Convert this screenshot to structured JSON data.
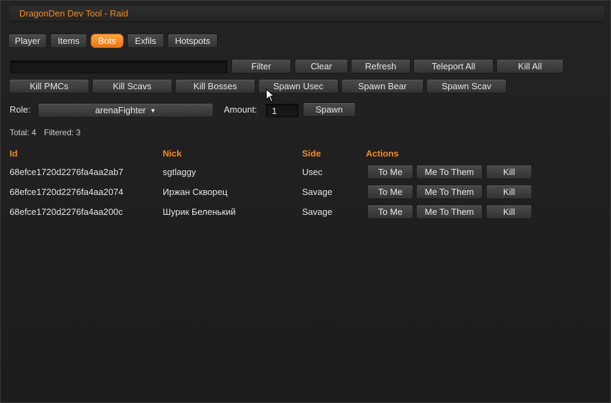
{
  "window": {
    "title": "DragonDen Dev Tool - Raid"
  },
  "tabs": [
    {
      "label": "Player",
      "active": false
    },
    {
      "label": "Items",
      "active": false
    },
    {
      "label": "Bots",
      "active": true
    },
    {
      "label": "Exfils",
      "active": false
    },
    {
      "label": "Hotspots",
      "active": false
    }
  ],
  "toolbar": {
    "search_value": "",
    "filter_label": "Filter",
    "clear_label": "Clear",
    "refresh_label": "Refresh",
    "teleport_all_label": "Teleport All",
    "kill_all_label": "Kill All",
    "kill_pmcs_label": "Kill PMCs",
    "kill_scavs_label": "Kill Scavs",
    "kill_bosses_label": "Kill Bosses",
    "spawn_usec_label": "Spawn Usec",
    "spawn_bear_label": "Spawn Bear",
    "spawn_scav_label": "Spawn Scav"
  },
  "spawn": {
    "role_label": "Role:",
    "role_value": "arenaFighter",
    "amount_label": "Amount:",
    "amount_value": "1",
    "spawn_label": "Spawn"
  },
  "stats": {
    "total": "Total: 4",
    "filtered": "Filtered: 3"
  },
  "table": {
    "headers": {
      "id": "Id",
      "nick": "Nick",
      "side": "Side",
      "actions": "Actions"
    },
    "action_labels": {
      "to_me": "To Me",
      "me_to_them": "Me To Them",
      "kill": "Kill"
    },
    "rows": [
      {
        "id": "68efce1720d2276fa4aa2ab7",
        "nick": "sgtlaggy",
        "side": "Usec"
      },
      {
        "id": "68efce1720d2276fa4aa2074",
        "nick": "Иржан Скворец",
        "side": "Savage"
      },
      {
        "id": "68efce1720d2276fa4aa200c",
        "nick": "Шурик Беленький",
        "side": "Savage"
      }
    ]
  },
  "colors": {
    "accent": "#f28a24",
    "background": "#1e1e1e",
    "button": "#3e3e3e"
  }
}
